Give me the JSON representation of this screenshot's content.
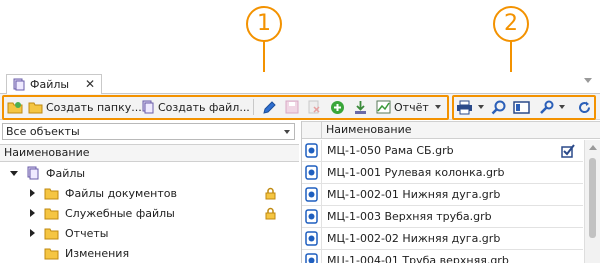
{
  "callouts": {
    "first": "1",
    "second": "2"
  },
  "tab": {
    "label": "Файлы",
    "close": "✕"
  },
  "toolbar": {
    "create_folder": "Создать папку...",
    "create_file": "Создать файл...",
    "report": "Отчёт"
  },
  "left": {
    "filter_value": "Все объекты",
    "column_header": "Наименование",
    "tree": [
      {
        "label": "Файлы"
      },
      {
        "label": "Файлы документов"
      },
      {
        "label": "Служебные файлы"
      },
      {
        "label": "Отчеты"
      },
      {
        "label": "Изменения"
      }
    ]
  },
  "right": {
    "column_header": "Наименование",
    "files": [
      {
        "name": "МЦ-1-050 Рама СБ.grb"
      },
      {
        "name": "МЦ-1-001 Рулевая колонка.grb"
      },
      {
        "name": "МЦ-1-002-01 Нижняя дуга.grb"
      },
      {
        "name": "МЦ-1-003 Верхняя труба.grb"
      },
      {
        "name": "МЦ-1-002-02 Нижняя дуга.grb"
      },
      {
        "name": "МЦ-1-004-01 Труба верхняя.grb"
      }
    ]
  },
  "colors": {
    "accent": "#f39200",
    "folder": "#f5c542",
    "grb_icon": "#1f5fbf"
  }
}
